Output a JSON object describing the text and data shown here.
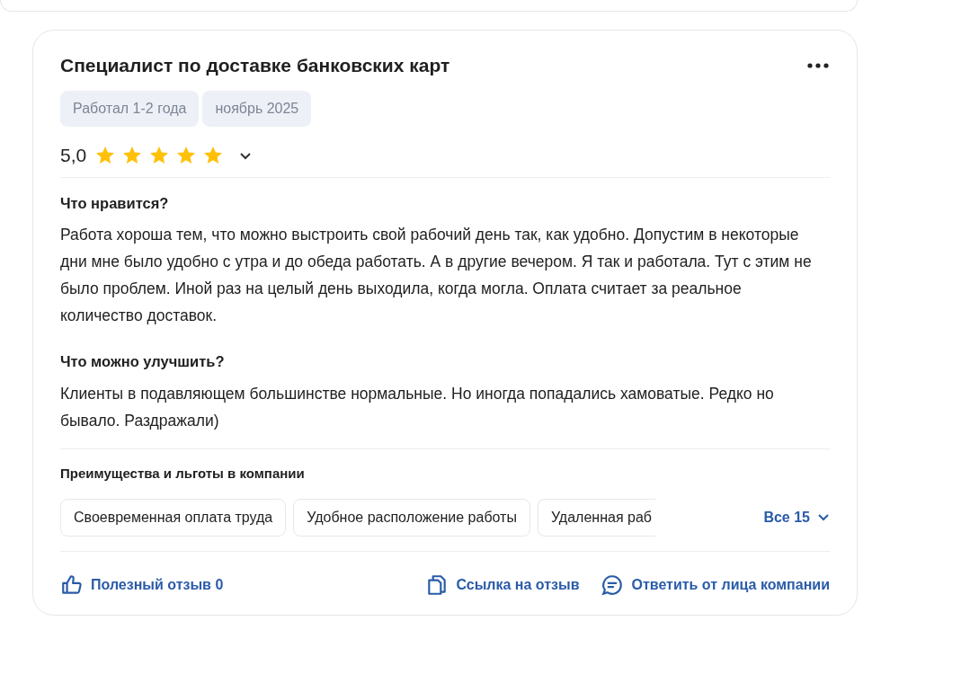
{
  "review": {
    "title": "Специалист по доставке банковских карт",
    "tags": [
      "Работал 1-2 года",
      "ноябрь 2025"
    ],
    "rating": "5,0",
    "stars": 5,
    "sections": [
      {
        "heading": "Что нравится?",
        "text": "Работа хороша тем, что можно выстроить свой рабочий день так, как удобно. Допустим в некоторые дни мне было удобно с утра и до обеда работать. А в другие вечером. Я так и работала. Тут с этим не было проблем. Иной раз на целый день выходила, когда могла. Оплата считает за реальное количество доставок."
      },
      {
        "heading": "Что можно улучшить?",
        "text": "Клиенты в подавляющем большинстве нормальные. Но иногда попадались хамоватые. Редко но бывало. Раздражали)"
      }
    ],
    "benefits_title": "Преимущества и льготы в компании",
    "benefits": [
      "Своевременная оплата труда",
      "Удобное расположение работы",
      "Удаленная раб"
    ],
    "benefits_more": "Все 15",
    "actions": [
      {
        "kind": "like",
        "label": "Полезный отзыв 0"
      },
      {
        "kind": "link",
        "label": "Ссылка на отзыв"
      },
      {
        "kind": "reply",
        "label": "Ответить от лица компании"
      }
    ]
  }
}
